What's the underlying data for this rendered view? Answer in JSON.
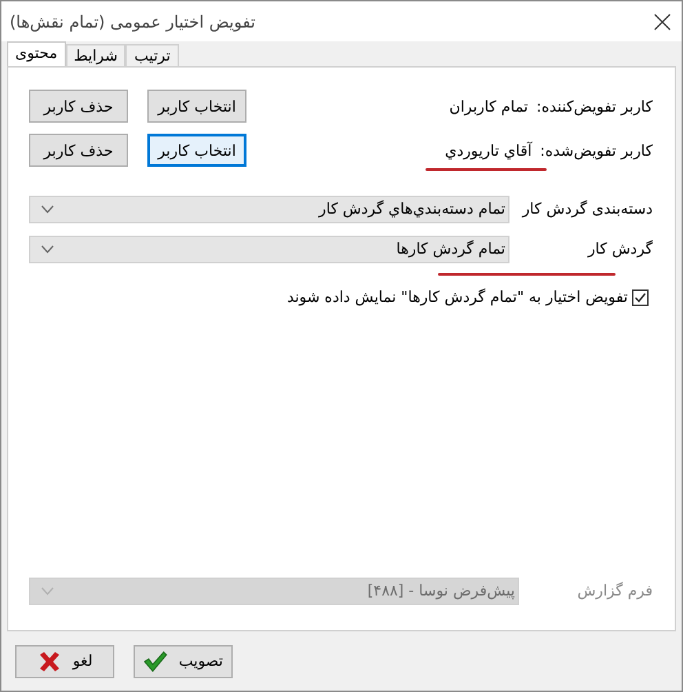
{
  "window": {
    "title": "تفویض اختیار عمومی (تمام نقش‌ها)"
  },
  "tabs": [
    {
      "label": "ترتیب",
      "selected": false
    },
    {
      "label": "شرایط",
      "selected": false
    },
    {
      "label": "محتوی",
      "selected": true
    }
  ],
  "user_rows": [
    {
      "label": "کاربر تفویض‌کننده:",
      "value": "تمام کاربران",
      "underlined": false,
      "buttons": [
        {
          "label": "انتخاب کاربر",
          "focused": false
        },
        {
          "label": "حذف کاربر",
          "focused": false
        }
      ]
    },
    {
      "label": "کاربر تفویض‌شده:",
      "value": "آقاي تاریوردي",
      "underlined": true,
      "buttons": [
        {
          "label": "انتخاب کاربر",
          "focused": true
        },
        {
          "label": "حذف کاربر",
          "focused": false
        }
      ]
    }
  ],
  "dropdowns": [
    {
      "label": "دسته‌بندی گردش کار",
      "value": "تمام دسته‌بندي‌هاي گردش کار",
      "underlined": false
    },
    {
      "label": "گردش کار",
      "value": "تمام گردش کارها",
      "underlined": true
    }
  ],
  "checkbox": {
    "label": "تفویض اختیار به \"تمام گردش کارها\" نمایش داده شوند",
    "checked": true
  },
  "report_form": {
    "label": "فرم گزارش",
    "value": "پیش‌فرض نوسا - [۴۸۸]",
    "disabled": true
  },
  "buttons": [
    {
      "label": "تصویب",
      "kind": "ok"
    },
    {
      "label": "لغو",
      "kind": "cancel"
    }
  ]
}
